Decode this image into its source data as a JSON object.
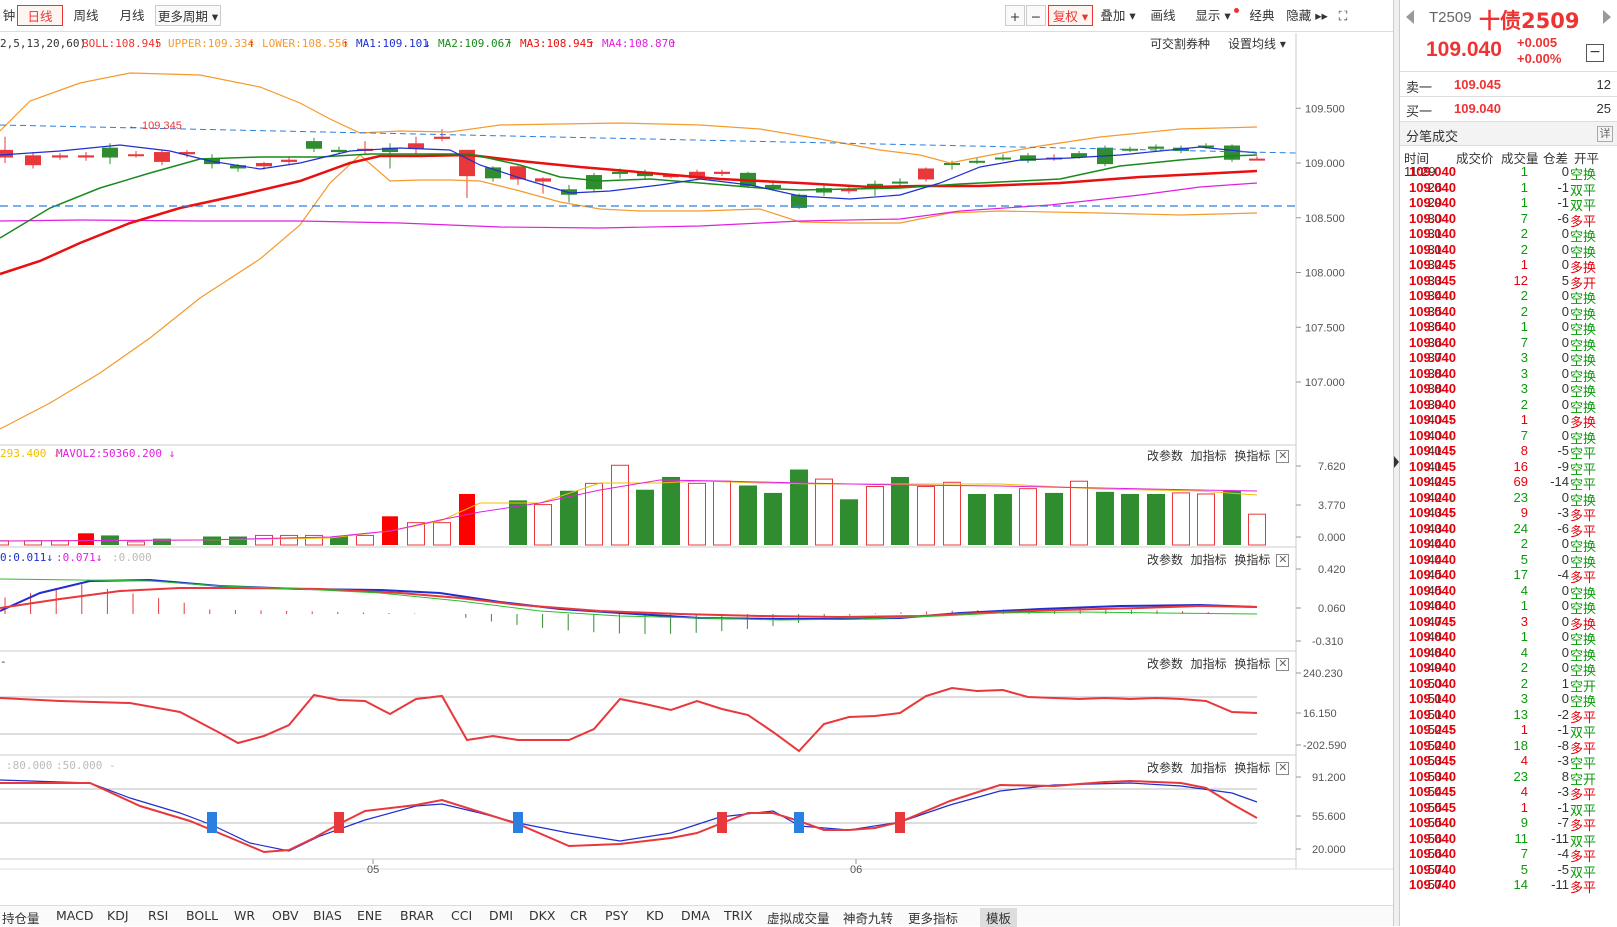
{
  "toolbar": {
    "items": [
      "钟",
      "日线",
      "周线",
      "月线",
      "更多周期 ▾"
    ],
    "right": [
      "+",
      "−",
      "复权 ▾",
      "叠加 ▾",
      "画线",
      "显示 ▾",
      "经典",
      "隐藏 ▸▸",
      "⛶"
    ]
  },
  "legend": {
    "params": "2,5,13,20,60)",
    "boll": "BOLL:108.945",
    "upper": "UPPER:109.334",
    "lower": "LOWER:108.556",
    "ma1": "MA1:109.101",
    "ma2": "MA2:109.067",
    "ma3": "MA3:108.945",
    "ma4": "MA4:108.870",
    "exchange": "可交割券种",
    "setma": "设置均线 ▾"
  },
  "price_axis": [
    "109.500",
    "109.000",
    "108.500",
    "108.000",
    "107.500",
    "107.000"
  ],
  "high_label": "109.345",
  "vol_legend": {
    "mavol1": "293.400",
    "mavol2": "MAVOL2:50360.200",
    "axis": [
      "7.620",
      "3.770",
      "0.000"
    ]
  },
  "macd_legend": {
    "a": "0:0.011",
    "b": ":0.071",
    "c": ":0.000",
    "axis": [
      "0.420",
      "0.060",
      "-0.310"
    ]
  },
  "cci_axis": [
    "240.230",
    "16.150",
    "-202.590"
  ],
  "kd_legend": {
    "a": ":80.000",
    "b": ":50.000",
    "axis": [
      "91.200",
      "55.600",
      "20.000"
    ]
  },
  "panel_tools": {
    "params": "改参数",
    "add": "加指标",
    "switch": "换指标",
    "close": "✕"
  },
  "xaxis": [
    "05",
    "06"
  ],
  "bottom_tabs": [
    "持仓量",
    "MACD",
    "KDJ",
    "RSI",
    "BOLL",
    "WR",
    "OBV",
    "BIAS",
    "ENE",
    "BRAR",
    "CCI",
    "DMI",
    "DKX",
    "CR",
    "PSY",
    "KD",
    "DMA",
    "TRIX",
    "虚拟成交量",
    "神奇九转",
    "更多指标",
    "模板"
  ],
  "side": {
    "code": "T2509",
    "name": "十债2509",
    "price": "109.040",
    "chg": "+0.005",
    "pct": "+0.00%",
    "minus": "−",
    "sell_label": "卖一",
    "sell_price": "109.045",
    "sell_qty": "12",
    "buy_label": "买一",
    "buy_price": "109.040",
    "buy_qty": "25",
    "trades_title": "分笔成交",
    "detail": "详",
    "hdr": [
      "时间",
      "成交价",
      "成交量",
      "仓差",
      "开平"
    ],
    "trades": [
      [
        "11:29",
        "109.040",
        "",
        "1",
        "0",
        "空换"
      ],
      [
        ":26",
        "109.040",
        "",
        "1",
        "-1",
        "双平"
      ],
      [
        ":29",
        "109.040",
        "",
        "1",
        "-1",
        "双平"
      ],
      [
        ":30",
        "109.040",
        "",
        "7",
        "-6",
        "多平"
      ],
      [
        ":31",
        "109.040",
        "",
        "2",
        "0",
        "空换"
      ],
      [
        ":31",
        "109.040",
        "",
        "2",
        "0",
        "空换"
      ],
      [
        ":32",
        "109.045",
        "↑",
        "1",
        "0",
        "多换"
      ],
      [
        ":33",
        "109.045",
        "",
        "12",
        "5",
        "多开"
      ],
      [
        ":34",
        "109.040",
        "↓",
        "2",
        "0",
        "空换"
      ],
      [
        ":35",
        "109.040",
        "",
        "2",
        "0",
        "空换"
      ],
      [
        ":35",
        "109.040",
        "",
        "1",
        "0",
        "空换"
      ],
      [
        ":36",
        "109.040",
        "",
        "7",
        "0",
        "空换"
      ],
      [
        ":37",
        "109.040",
        "",
        "3",
        "0",
        "空换"
      ],
      [
        ":38",
        "109.040",
        "",
        "3",
        "0",
        "空换"
      ],
      [
        ":38",
        "109.040",
        "",
        "3",
        "0",
        "空换"
      ],
      [
        ":39",
        "109.040",
        "",
        "2",
        "0",
        "空换"
      ],
      [
        ":40",
        "109.045",
        "↑",
        "1",
        "0",
        "多换"
      ],
      [
        ":40",
        "109.040",
        "↓",
        "7",
        "0",
        "空换"
      ],
      [
        ":41",
        "109.045",
        "↑",
        "8",
        "-5",
        "空平"
      ],
      [
        ":41",
        "109.045",
        "",
        "16",
        "-9",
        "空平"
      ],
      [
        ":42",
        "109.045",
        "",
        "69",
        "-14",
        "空平"
      ],
      [
        ":42",
        "109.040",
        "↓",
        "23",
        "0",
        "空换"
      ],
      [
        ":43",
        "109.045",
        "↑",
        "9",
        "-3",
        "多平"
      ],
      [
        ":43",
        "109.040",
        "↓",
        "24",
        "-6",
        "多平"
      ],
      [
        ":44",
        "109.040",
        "",
        "2",
        "0",
        "空换"
      ],
      [
        ":44",
        "109.040",
        "",
        "5",
        "0",
        "空换"
      ],
      [
        ":45",
        "109.040",
        "",
        "17",
        "-4",
        "多平"
      ],
      [
        ":45",
        "109.040",
        "",
        "4",
        "0",
        "空换"
      ],
      [
        ":46",
        "109.040",
        "",
        "1",
        "0",
        "空换"
      ],
      [
        ":47",
        "109.045",
        "↑",
        "3",
        "0",
        "多换"
      ],
      [
        ":48",
        "109.040",
        "↓",
        "1",
        "0",
        "空换"
      ],
      [
        ":48",
        "109.040",
        "",
        "4",
        "0",
        "空换"
      ],
      [
        ":49",
        "109.040",
        "",
        "2",
        "0",
        "空换"
      ],
      [
        ":50",
        "109.040",
        "",
        "2",
        "1",
        "空开"
      ],
      [
        ":51",
        "109.040",
        "",
        "3",
        "0",
        "空换"
      ],
      [
        ":51",
        "109.040",
        "",
        "13",
        "-2",
        "多平"
      ],
      [
        ":52",
        "109.045",
        "↑",
        "1",
        "-1",
        "双平"
      ],
      [
        ":52",
        "109.040",
        "↓",
        "18",
        "-8",
        "多平"
      ],
      [
        ":53",
        "109.045",
        "↑",
        "4",
        "-3",
        "空平"
      ],
      [
        ":53",
        "109.040",
        "↓",
        "23",
        "8",
        "空开"
      ],
      [
        ":54",
        "109.045",
        "↑",
        "4",
        "-3",
        "多平"
      ],
      [
        ":55",
        "109.045",
        "",
        "1",
        "-1",
        "双平"
      ],
      [
        ":55",
        "109.040",
        "↓",
        "9",
        "-7",
        "多平"
      ],
      [
        ":56",
        "109.040",
        "",
        "11",
        "-11",
        "双平"
      ],
      [
        ":56",
        "109.040",
        "",
        "7",
        "-4",
        "多平"
      ],
      [
        ":57",
        "109.040",
        "",
        "5",
        "-5",
        "双平"
      ],
      [
        ":57",
        "109.040",
        "",
        "14",
        "-11",
        "多平"
      ]
    ]
  },
  "colors": {
    "up": "#e8383c",
    "down": "#2f8d2f",
    "accent": "#e33",
    "ma1": "#1f2fd0",
    "ma2": "#1a8a1a",
    "ma3": "#e81010",
    "ma4": "#e020e0",
    "boll": "#f59a2c",
    "dash": "#2a7fe0"
  }
}
